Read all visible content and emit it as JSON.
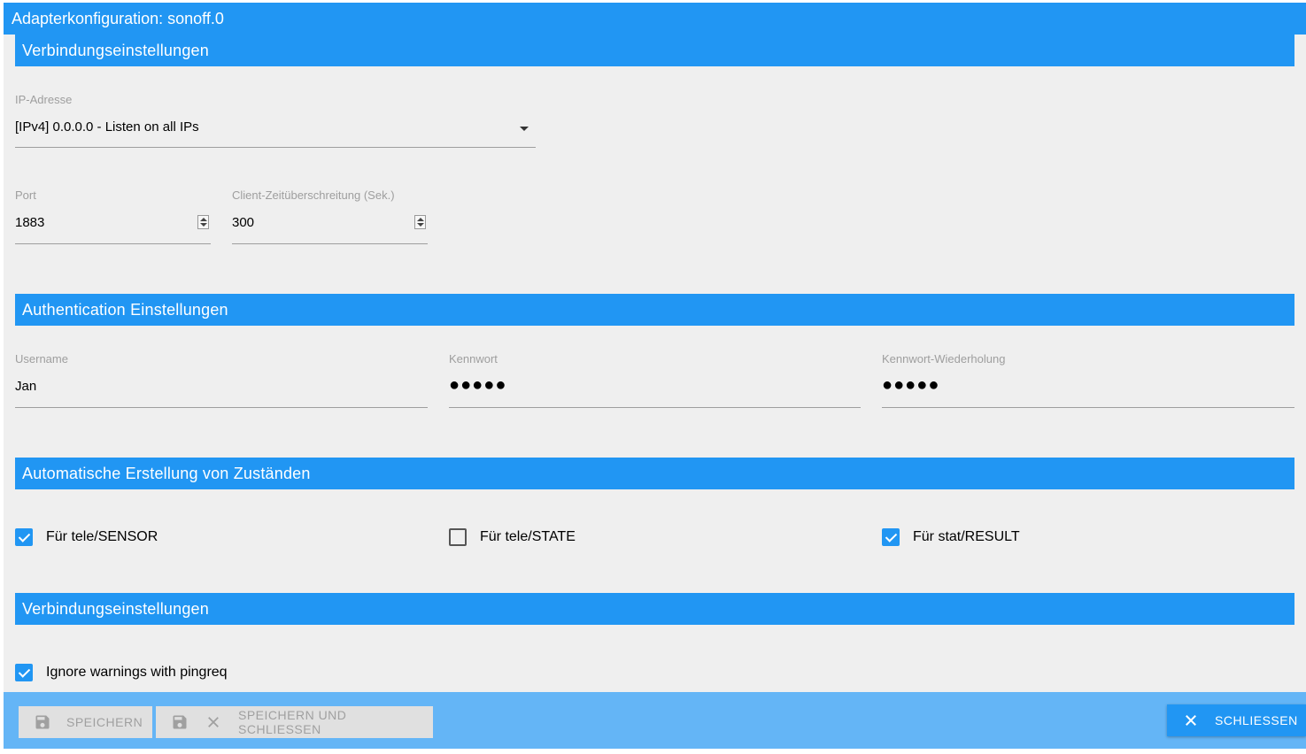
{
  "window": {
    "title": "Adapterkonfiguration: sonoff.0"
  },
  "sections": {
    "connection": {
      "header": "Verbindungseinstellungen"
    },
    "auth": {
      "header": "Authentication Einstellungen"
    },
    "states": {
      "header": "Automatische Erstellung von Zuständen"
    },
    "connection2": {
      "header": "Verbindungseinstellungen"
    }
  },
  "fields": {
    "ip": {
      "label": "IP-Adresse",
      "value": "[IPv4] 0.0.0.0 - Listen on all IPs"
    },
    "port": {
      "label": "Port",
      "value": "1883"
    },
    "timeout": {
      "label": "Client-Zeitüberschreitung (Sek.)",
      "value": "300"
    },
    "username": {
      "label": "Username",
      "value": "Jan"
    },
    "password": {
      "label": "Kennwort",
      "value": "●●●●●"
    },
    "password_repeat": {
      "label": "Kennwort-Wiederholung",
      "value": "●●●●●"
    }
  },
  "checkboxes": {
    "tele_sensor": {
      "label": "Für tele/SENSOR",
      "checked": true
    },
    "tele_state": {
      "label": "Für tele/STATE",
      "checked": false
    },
    "stat_result": {
      "label": "Für stat/RESULT",
      "checked": true
    },
    "pingreq": {
      "label": "Ignore warnings with pingreq",
      "checked": true
    }
  },
  "footer": {
    "save": "SPEICHERN",
    "save_close": "SPEICHERN UND SCHLIESSEN",
    "close": "SCHLIESSEN"
  },
  "colors": {
    "accent": "#2196f3",
    "footer": "#64b5f6",
    "background": "#efefef"
  }
}
